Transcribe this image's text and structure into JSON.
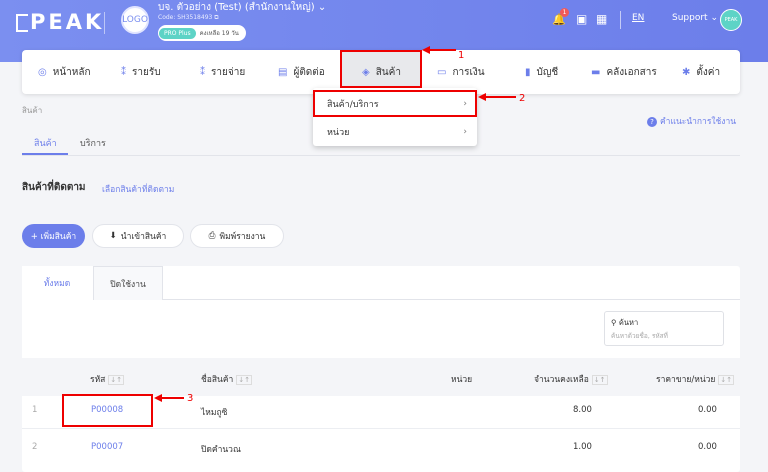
{
  "header": {
    "logo": "PEAK",
    "org_logo_text": "LOGO",
    "org_name": "บจ. ตัวอย่าง (Test) (สำนักงานใหญ่)",
    "org_code": "Code: SH3518493",
    "plan_badge": "PRO Plus",
    "plan_remaining": "คงเหลือ 19 วัน",
    "notification_count": "1",
    "language": "EN",
    "support_label": "Support",
    "avatar_text": "PEAK"
  },
  "nav": {
    "items": [
      {
        "label": "หน้าหลัก",
        "icon": "dashboard-icon"
      },
      {
        "label": "รายรับ",
        "icon": "income-icon"
      },
      {
        "label": "รายจ่าย",
        "icon": "expense-icon"
      },
      {
        "label": "ผู้ติดต่อ",
        "icon": "contact-icon"
      },
      {
        "label": "สินค้า",
        "icon": "product-box-icon"
      },
      {
        "label": "การเงิน",
        "icon": "finance-icon"
      },
      {
        "label": "บัญชี",
        "icon": "accounting-book-icon"
      },
      {
        "label": "คลังเอกสาร",
        "icon": "folder-icon"
      },
      {
        "label": "ตั้งค่า",
        "icon": "settings-gear-icon"
      }
    ]
  },
  "dropdown": {
    "items": [
      {
        "label": "สินค้า/บริการ"
      },
      {
        "label": "หน่วย"
      }
    ]
  },
  "annotations": [
    "1",
    "2",
    "3"
  ],
  "breadcrumb": "สินค้า",
  "guide_link": "คำแนะนำการใช้งาน",
  "page_tabs": [
    "สินค้า",
    "บริการ"
  ],
  "section": {
    "title": "สินค้าที่ติดตาม",
    "link": "เลือกสินค้าที่ติดตาม"
  },
  "actions": {
    "add": "+ เพิ่มสินค้า",
    "import": "นำเข้าสินค้า",
    "print": "พิมพ์รายงาน"
  },
  "list_tabs": [
    "ทั้งหมด",
    "ปิดใช้งาน"
  ],
  "search": {
    "label": "ค้นหา",
    "placeholder": "ค้นหาด้วยชื่อ, รหัสที่"
  },
  "table": {
    "headers": [
      "รหัส",
      "ชื่อสินค้า",
      "หน่วย",
      "จำนวนคงเหลือ",
      "ราคาขาย/หน่วย"
    ],
    "rows": [
      {
        "index": "1",
        "code": "P00008",
        "name": "ไหมถูซิ",
        "unit": "",
        "qty": "8.00",
        "price": "0.00"
      },
      {
        "index": "2",
        "code": "P00007",
        "name": "ปิดคำนวณ",
        "unit": "",
        "qty": "1.00",
        "price": "0.00"
      }
    ]
  },
  "colors": {
    "header_bg": "#7b8ff0",
    "accent": "#6c7eea",
    "annotation": "#e00000"
  }
}
